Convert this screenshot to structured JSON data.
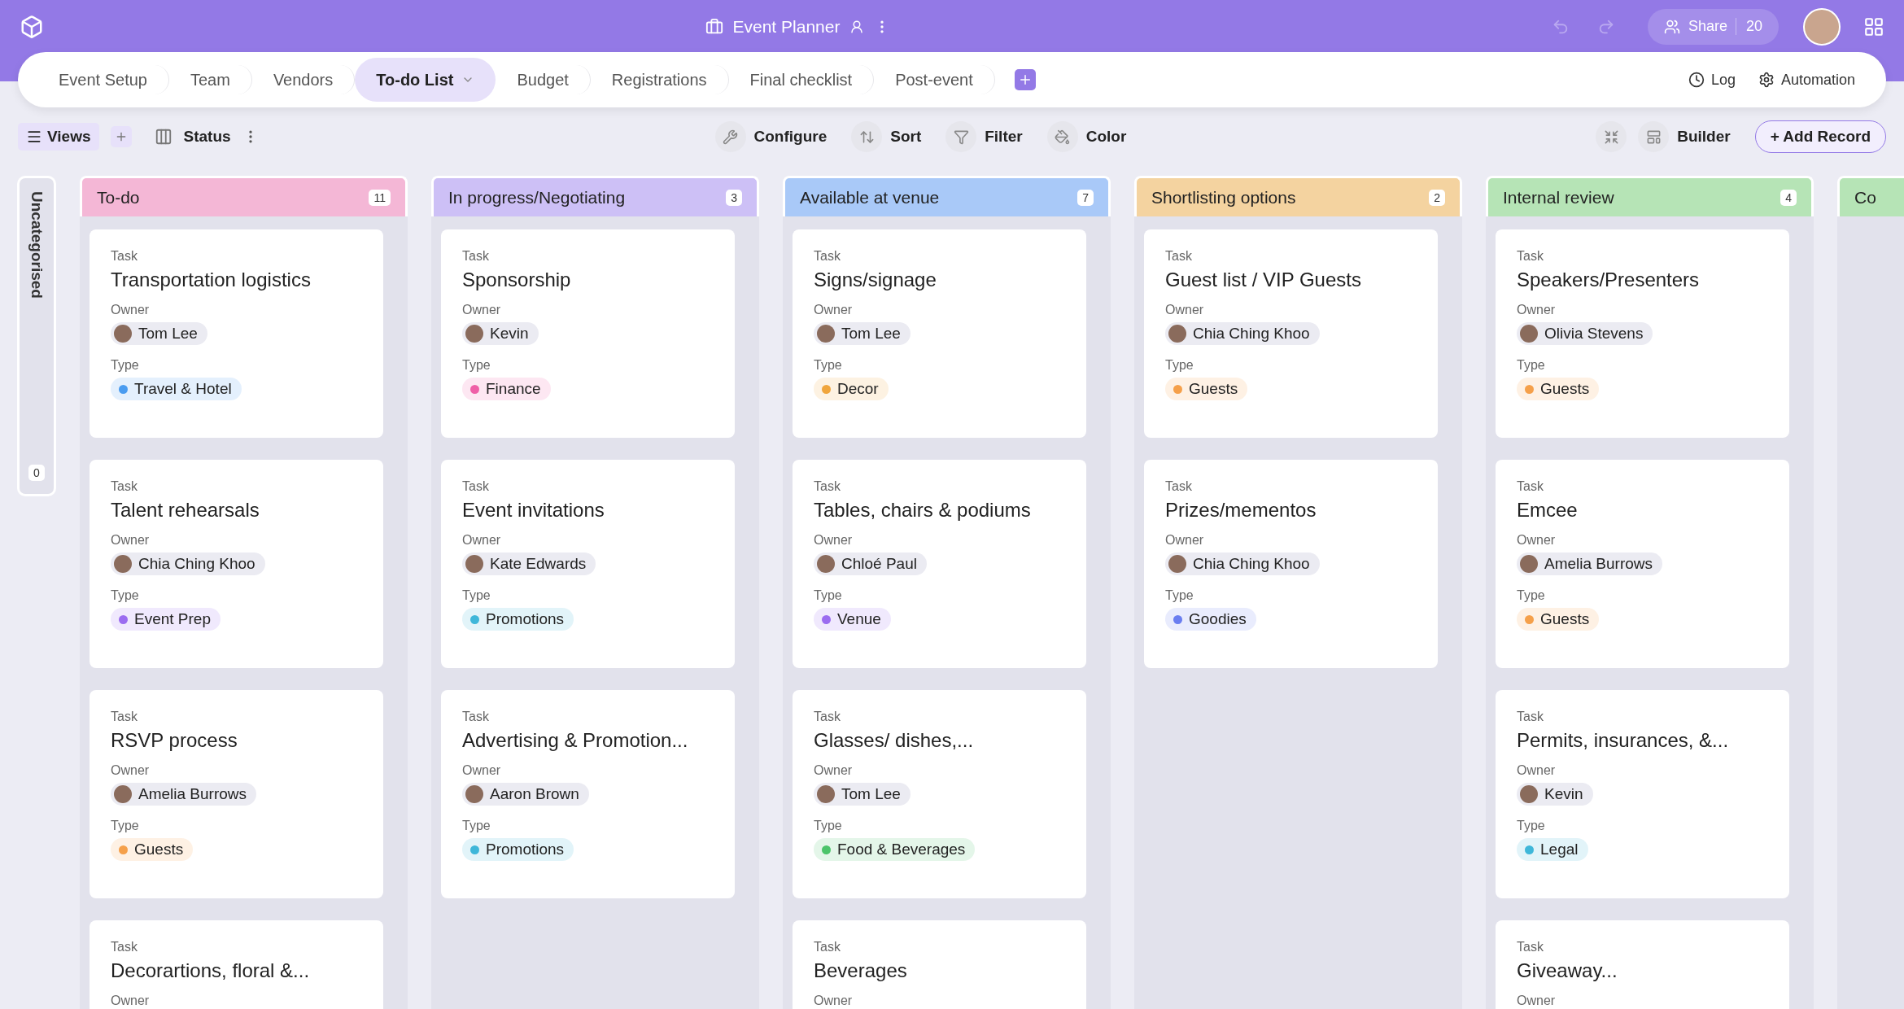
{
  "app": {
    "title": "Event Planner",
    "share_label": "Share",
    "share_count": "20"
  },
  "tabs": [
    {
      "label": "Event Setup",
      "selected": false
    },
    {
      "label": "Team",
      "selected": false
    },
    {
      "label": "Vendors",
      "selected": false
    },
    {
      "label": "To-do List",
      "selected": true
    },
    {
      "label": "Budget",
      "selected": false
    },
    {
      "label": "Registrations",
      "selected": false
    },
    {
      "label": "Final checklist",
      "selected": false
    },
    {
      "label": "Post-event",
      "selected": false
    }
  ],
  "tab_actions": [
    "Log",
    "Automation"
  ],
  "toolbar": {
    "views_label": "Views",
    "view_name": "Status",
    "center_actions": [
      "Configure",
      "Sort",
      "Filter",
      "Color"
    ],
    "builder_label": "Builder",
    "add_record_label": "+ Add Record"
  },
  "uncategorised": {
    "label": "Uncategorised",
    "count": "0"
  },
  "columns": [
    {
      "title": "To-do",
      "count": "11",
      "color": "#f4b7d6",
      "cards": [
        {
          "task_label": "Task",
          "task": "Transportation logistics",
          "owner_label": "Owner",
          "owner": "Tom Lee",
          "type_label": "Type",
          "type": {
            "label": "Travel & Hotel",
            "color": "#4a9cf0"
          }
        },
        {
          "task_label": "Task",
          "task": "Talent rehearsals",
          "owner_label": "Owner",
          "owner": "Chia Ching Khoo",
          "type_label": "Type",
          "type": {
            "label": "Event Prep",
            "color": "#9b6cf0"
          }
        },
        {
          "task_label": "Task",
          "task": "RSVP process",
          "owner_label": "Owner",
          "owner": "Amelia Burrows",
          "type_label": "Type",
          "type": {
            "label": "Guests",
            "color": "#f5a04a"
          }
        },
        {
          "task_label": "Task",
          "task": "Decorartions, floral &...",
          "owner_label": "Owner"
        }
      ]
    },
    {
      "title": "In progress/Negotiating",
      "count": "3",
      "color": "#cdc0f6",
      "cards": [
        {
          "task_label": "Task",
          "task": "Sponsorship",
          "owner_label": "Owner",
          "owner": "Kevin",
          "type_label": "Type",
          "type": {
            "label": "Finance",
            "color": "#ef5fa7"
          }
        },
        {
          "task_label": "Task",
          "task": "Event invitations",
          "owner_label": "Owner",
          "owner": "Kate Edwards",
          "type_label": "Type",
          "type": {
            "label": "Promotions",
            "color": "#3fb7d9"
          }
        },
        {
          "task_label": "Task",
          "task": "Advertising & Promotion...",
          "owner_label": "Owner",
          "owner": "Aaron Brown",
          "type_label": "Type",
          "type": {
            "label": "Promotions",
            "color": "#3fb7d9"
          }
        }
      ]
    },
    {
      "title": "Available at venue",
      "count": "7",
      "color": "#a9c9f8",
      "cards": [
        {
          "task_label": "Task",
          "task": "Signs/signage",
          "owner_label": "Owner",
          "owner": "Tom Lee",
          "type_label": "Type",
          "type": {
            "label": "Decor",
            "color": "#f0a53c"
          }
        },
        {
          "task_label": "Task",
          "task": "Tables, chairs & podiums",
          "owner_label": "Owner",
          "owner": "Chloé Paul",
          "type_label": "Type",
          "type": {
            "label": "Venue",
            "color": "#9b6cf0"
          }
        },
        {
          "task_label": "Task",
          "task": "Glasses/ dishes,...",
          "owner_label": "Owner",
          "owner": "Tom Lee",
          "type_label": "Type",
          "type": {
            "label": "Food & Beverages",
            "color": "#4cc46a"
          }
        },
        {
          "task_label": "Task",
          "task": "Beverages",
          "owner_label": "Owner"
        }
      ]
    },
    {
      "title": "Shortlisting options",
      "count": "2",
      "color": "#f4d3a0",
      "cards": [
        {
          "task_label": "Task",
          "task": "Guest list / VIP Guests",
          "owner_label": "Owner",
          "owner": "Chia Ching Khoo",
          "type_label": "Type",
          "type": {
            "label": "Guests",
            "color": "#f5a04a"
          }
        },
        {
          "task_label": "Task",
          "task": "Prizes/mementos",
          "owner_label": "Owner",
          "owner": "Chia Ching Khoo",
          "type_label": "Type",
          "type": {
            "label": "Goodies",
            "color": "#6a7ef0"
          }
        }
      ]
    },
    {
      "title": "Internal review",
      "count": "4",
      "color": "#b6e4b6",
      "cards": [
        {
          "task_label": "Task",
          "task": "Speakers/Presenters",
          "owner_label": "Owner",
          "owner": "Olivia Stevens",
          "type_label": "Type",
          "type": {
            "label": "Guests",
            "color": "#f5a04a"
          }
        },
        {
          "task_label": "Task",
          "task": "Emcee",
          "owner_label": "Owner",
          "owner": "Amelia Burrows",
          "type_label": "Type",
          "type": {
            "label": "Guests",
            "color": "#f5a04a"
          }
        },
        {
          "task_label": "Task",
          "task": "Permits, insurances, &...",
          "owner_label": "Owner",
          "owner": "Kevin",
          "type_label": "Type",
          "type": {
            "label": "Legal",
            "color": "#3fb7d9"
          }
        },
        {
          "task_label": "Task",
          "task": "Giveaway...",
          "owner_label": "Owner"
        }
      ]
    },
    {
      "title": "Co",
      "color": "#b6e4b6"
    }
  ]
}
